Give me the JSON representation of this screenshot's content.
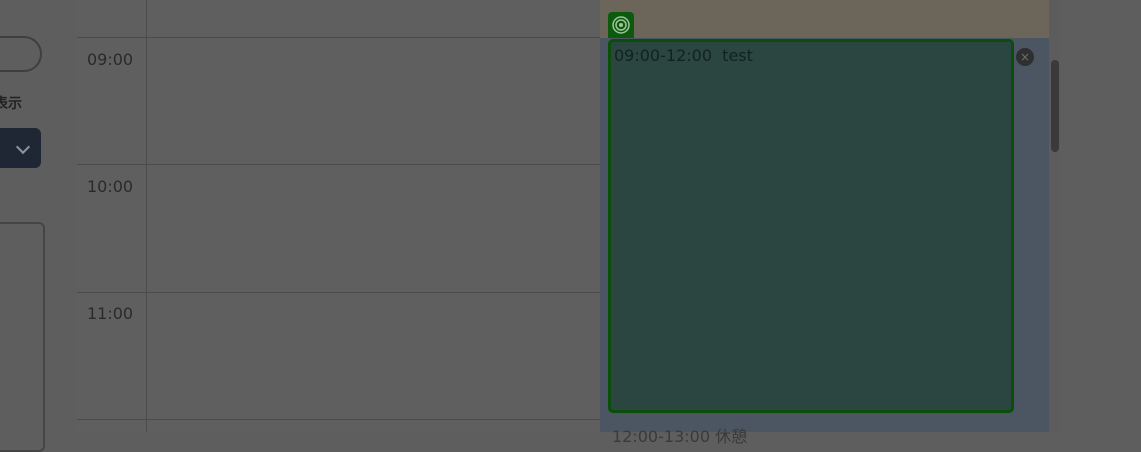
{
  "sidebar": {
    "label_fragment": "表示"
  },
  "time_slots": [
    "09:00",
    "10:00",
    "11:00"
  ],
  "event": {
    "title": "09:00-12:00  test",
    "close_icon": "×",
    "type_icon": "target-icon"
  },
  "next_event": {
    "text": "12:00-13:00  休憩"
  },
  "colors": {
    "event_bg": "#2b4541",
    "event_border": "#0b4e0b",
    "icon_tab": "#0c5a0c"
  }
}
